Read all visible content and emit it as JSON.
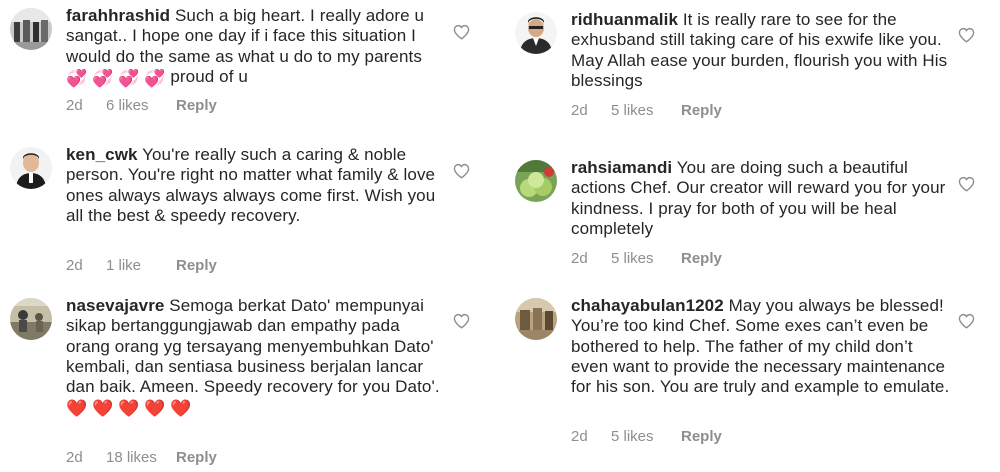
{
  "comments_left": [
    {
      "username": "farahhrashid",
      "text_before": " Such a big heart. I really adore u sangat.. I hope one day if i face this situation I would do the same as what u do to my parents",
      "emoji": "💞 💞 💞 💞",
      "text_after": " proud of u",
      "time": "2d",
      "likes": "6 likes",
      "reply_label": "Reply"
    },
    {
      "username": "ken_cwk",
      "text": " You're really such a caring & noble person. You're right no matter what family & love ones always always always come first. Wish you all the best & speedy recovery.",
      "time": "2d",
      "likes": "1 like",
      "reply_label": "Reply"
    },
    {
      "username": "nasevajavre",
      "text": " Semoga berkat Dato' mempunyai sikap bertanggungjawab dan empathy pada orang orang yg tersayang menyembuhkan Dato' kembali, dan sentiasa business berjalan lancar dan baik. Ameen. Speedy recovery for you Dato'. ",
      "emoji": "❤️ ❤️ ❤️ ❤️ ❤️",
      "time": "2d",
      "likes": "18 likes",
      "reply_label": "Reply"
    }
  ],
  "comments_right": [
    {
      "username": "ridhuanmalik",
      "text": " It is really rare to see for the exhusband still taking care of his exwife like you. May Allah ease your burden, flourish you with His blessings",
      "time": "2d",
      "likes": "5 likes",
      "reply_label": "Reply"
    },
    {
      "username": "rahsiamandi",
      "text": " You are doing such a beautiful actions Chef. Our creator will reward you for your kindness. I pray for both of you will be heal completely",
      "time": "2d",
      "likes": "5 likes",
      "reply_label": "Reply"
    },
    {
      "username": "chahayabulan1202",
      "text": " May you always be blessed! You’re too kind Chef. Some exes can’t even be bothered to help. The father of my child don’t even want to provide the necessary maintenance for his son. You are truly and example to emulate.",
      "time": "2d",
      "likes": "5 likes",
      "reply_label": "Reply"
    }
  ],
  "icons": {
    "like": "heart-outline-icon"
  },
  "colors": {
    "text": "#262626",
    "meta": "#8e8e8e",
    "heart_outline": "#8e8e8e",
    "emoji_heart": "#e0245e",
    "emoji_pink": "#f06292"
  }
}
